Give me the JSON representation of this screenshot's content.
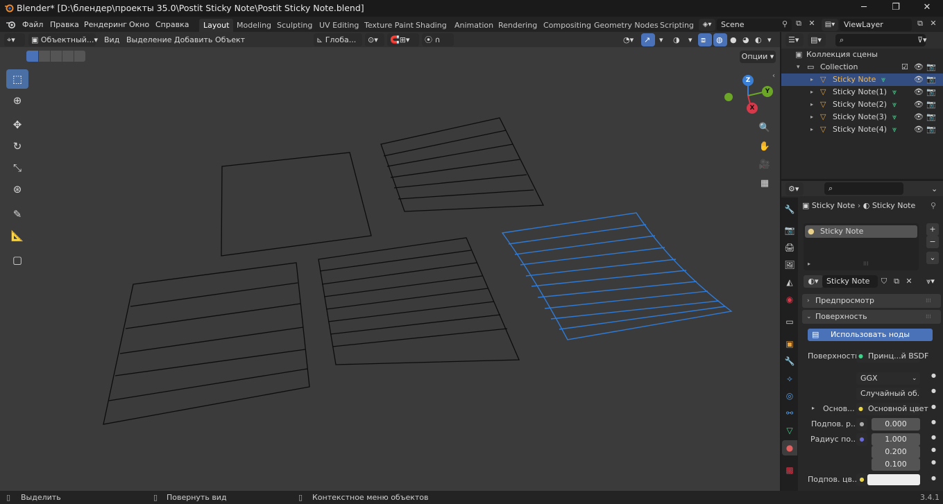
{
  "titlebar": {
    "title": "Blender* [D:\\блендер\\проекты 35.0\\Postit Sticky Note\\Postit Sticky Note.blend]"
  },
  "menu": {
    "items": [
      "Файл",
      "Правка",
      "Рендеринг",
      "Окно",
      "Справка"
    ]
  },
  "workspaces": [
    "Layout",
    "Modeling",
    "Sculpting",
    "UV Editing",
    "Texture Paint",
    "Shading",
    "Animation",
    "Rendering",
    "Compositing",
    "Geometry Nodes",
    "Scripting"
  ],
  "scene": {
    "name": "Scene",
    "view_layer": "ViewLayer"
  },
  "viewport_header": {
    "mode": "Объектный...",
    "view": "Вид",
    "select": "Выделение",
    "add": "Добавить",
    "object": "Объект",
    "orientation": "Глоба...",
    "options": "Опции"
  },
  "gizmo": {
    "x": "X",
    "y": "Y",
    "z": "Z"
  },
  "outliner": {
    "scene_collection": "Коллекция сцены",
    "collection": "Collection",
    "objects": [
      "Sticky Note",
      "Sticky Note(1)",
      "Sticky Note(2)",
      "Sticky Note(3)",
      "Sticky Note(4)"
    ]
  },
  "properties": {
    "breadcrumb_object": "Sticky Note",
    "breadcrumb_material": "Sticky Note",
    "slot_name": "Sticky Note",
    "material_name": "Sticky Note",
    "panel_preview": "Предпросмотр",
    "panel_surface": "Поверхность",
    "use_nodes_label": "Использовать ноды",
    "surface_label": "Поверхность",
    "surface_value": "Принц...й BSDF",
    "distribution": "GGX",
    "subsurface_method": "Случайный об...",
    "base_label": "Основ...",
    "base_value": "Основной цвет",
    "subsurface_label": "Подпов. р...",
    "subsurface_value": "0.000",
    "radius_label": "Радиус по...",
    "radius_values": [
      "1.000",
      "0.200",
      "0.100"
    ],
    "subsurface_color_label": "Подпов. цв..."
  },
  "statusbar": {
    "select": "Выделить",
    "rotate": "Повернуть вид",
    "context": "Контекстное меню объектов",
    "version": "3.4.1"
  },
  "colors": {
    "selected_wire": "#2f7bd8",
    "accent": "#4a72b8",
    "title_orange": "#e8a33b"
  }
}
